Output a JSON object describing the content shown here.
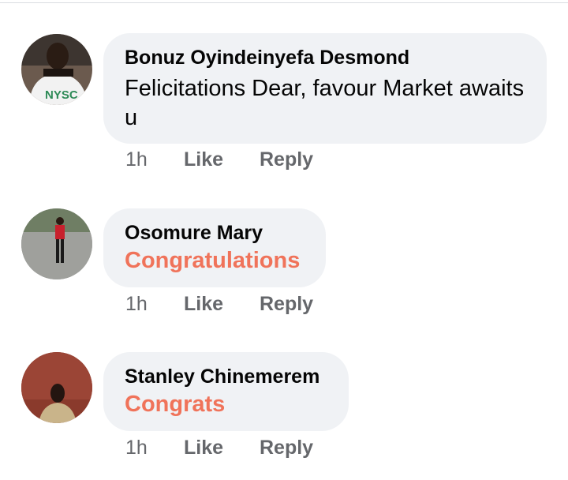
{
  "comments": [
    {
      "author": "Bonuz Oyindeinyefa Desmond",
      "text": "Felicitations Dear,  favour Market awaits u",
      "time": "1h",
      "like_label": "Like",
      "reply_label": "Reply",
      "avatar_shirt_text": "NYSC"
    },
    {
      "author": "Osomure Mary",
      "text": "Congratulations",
      "time": "1h",
      "like_label": "Like",
      "reply_label": "Reply"
    },
    {
      "author": "Stanley Chinemerem",
      "text": "Congrats",
      "time": "1h",
      "like_label": "Like",
      "reply_label": "Reply"
    }
  ],
  "colors": {
    "bubble": "#f0f2f5",
    "accent_text": "#f0735a",
    "meta_text": "#65676b"
  }
}
